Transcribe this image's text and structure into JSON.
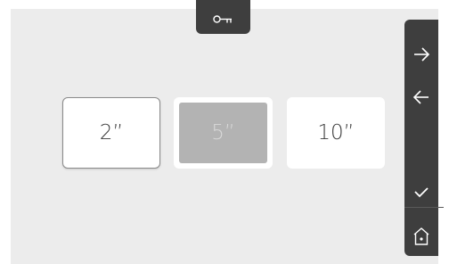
{
  "options": [
    {
      "label": "2”",
      "state": "outlined"
    },
    {
      "label": "5”",
      "state": "selected"
    },
    {
      "label": "10”",
      "state": "normal"
    }
  ],
  "icons": {
    "top_tab": "key-icon",
    "sidebar": [
      "arrow-right-icon",
      "arrow-left-icon",
      "check-icon",
      "home-icon"
    ]
  },
  "colors": {
    "background": "#ececec",
    "panel": "#3e3e3e",
    "selected_fill": "#b3b3b3",
    "icon": "#ffffff"
  }
}
